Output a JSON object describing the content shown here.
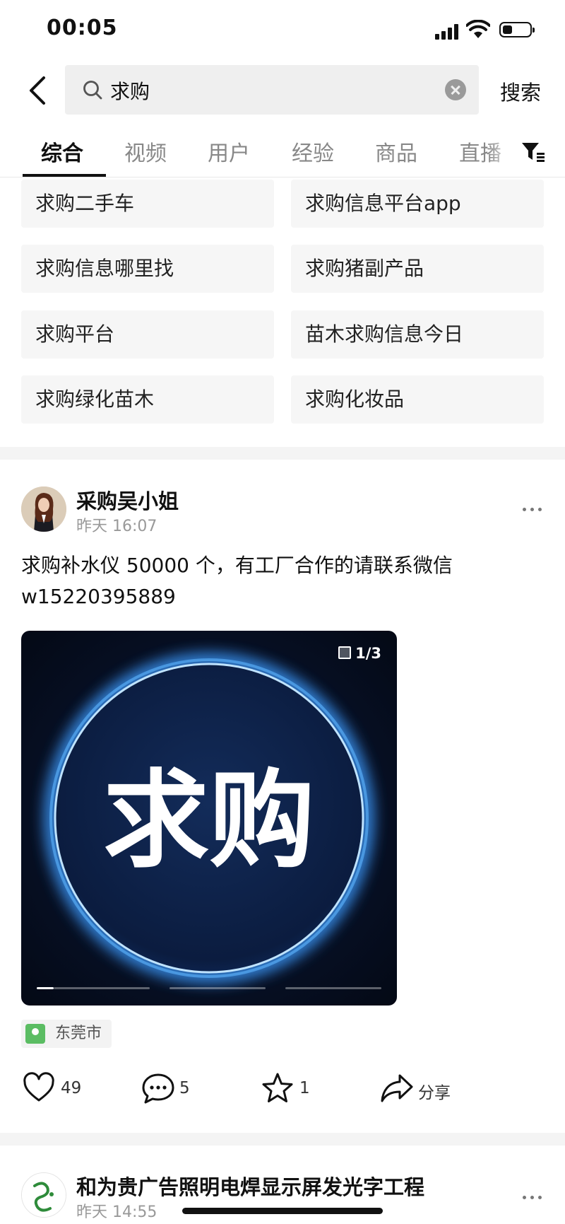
{
  "status_bar": {
    "time": "00:05"
  },
  "search": {
    "query": "求购",
    "button_label": "搜索"
  },
  "tabs": [
    {
      "label": "综合",
      "active": true
    },
    {
      "label": "视频"
    },
    {
      "label": "用户"
    },
    {
      "label": "经验"
    },
    {
      "label": "商品"
    },
    {
      "label": "直播"
    }
  ],
  "suggestions": [
    "求购二手车",
    "求购信息平台app",
    "求购信息哪里找",
    "求购猪副产品",
    "求购平台",
    "苗木求购信息今日",
    "求购绿化苗木",
    "求购化妆品"
  ],
  "post1": {
    "author": "采购吴小姐",
    "time": "昨天 16:07",
    "text": "求购补水仪 50000 个，有工厂合作的请联系微信 w15220395889",
    "image_text": "求购",
    "image_counter": "1/3",
    "location": "东莞市",
    "likes": "49",
    "comments": "5",
    "favorites": "1",
    "share_label": "分享"
  },
  "post2": {
    "author": "和为贵广告照明电焊显示屏发光字工程",
    "time": "昨天 14:55"
  },
  "colors": {
    "location_pin": "#5bbd63",
    "image_bg": "#07122a",
    "glow": "#4aa8ff"
  }
}
